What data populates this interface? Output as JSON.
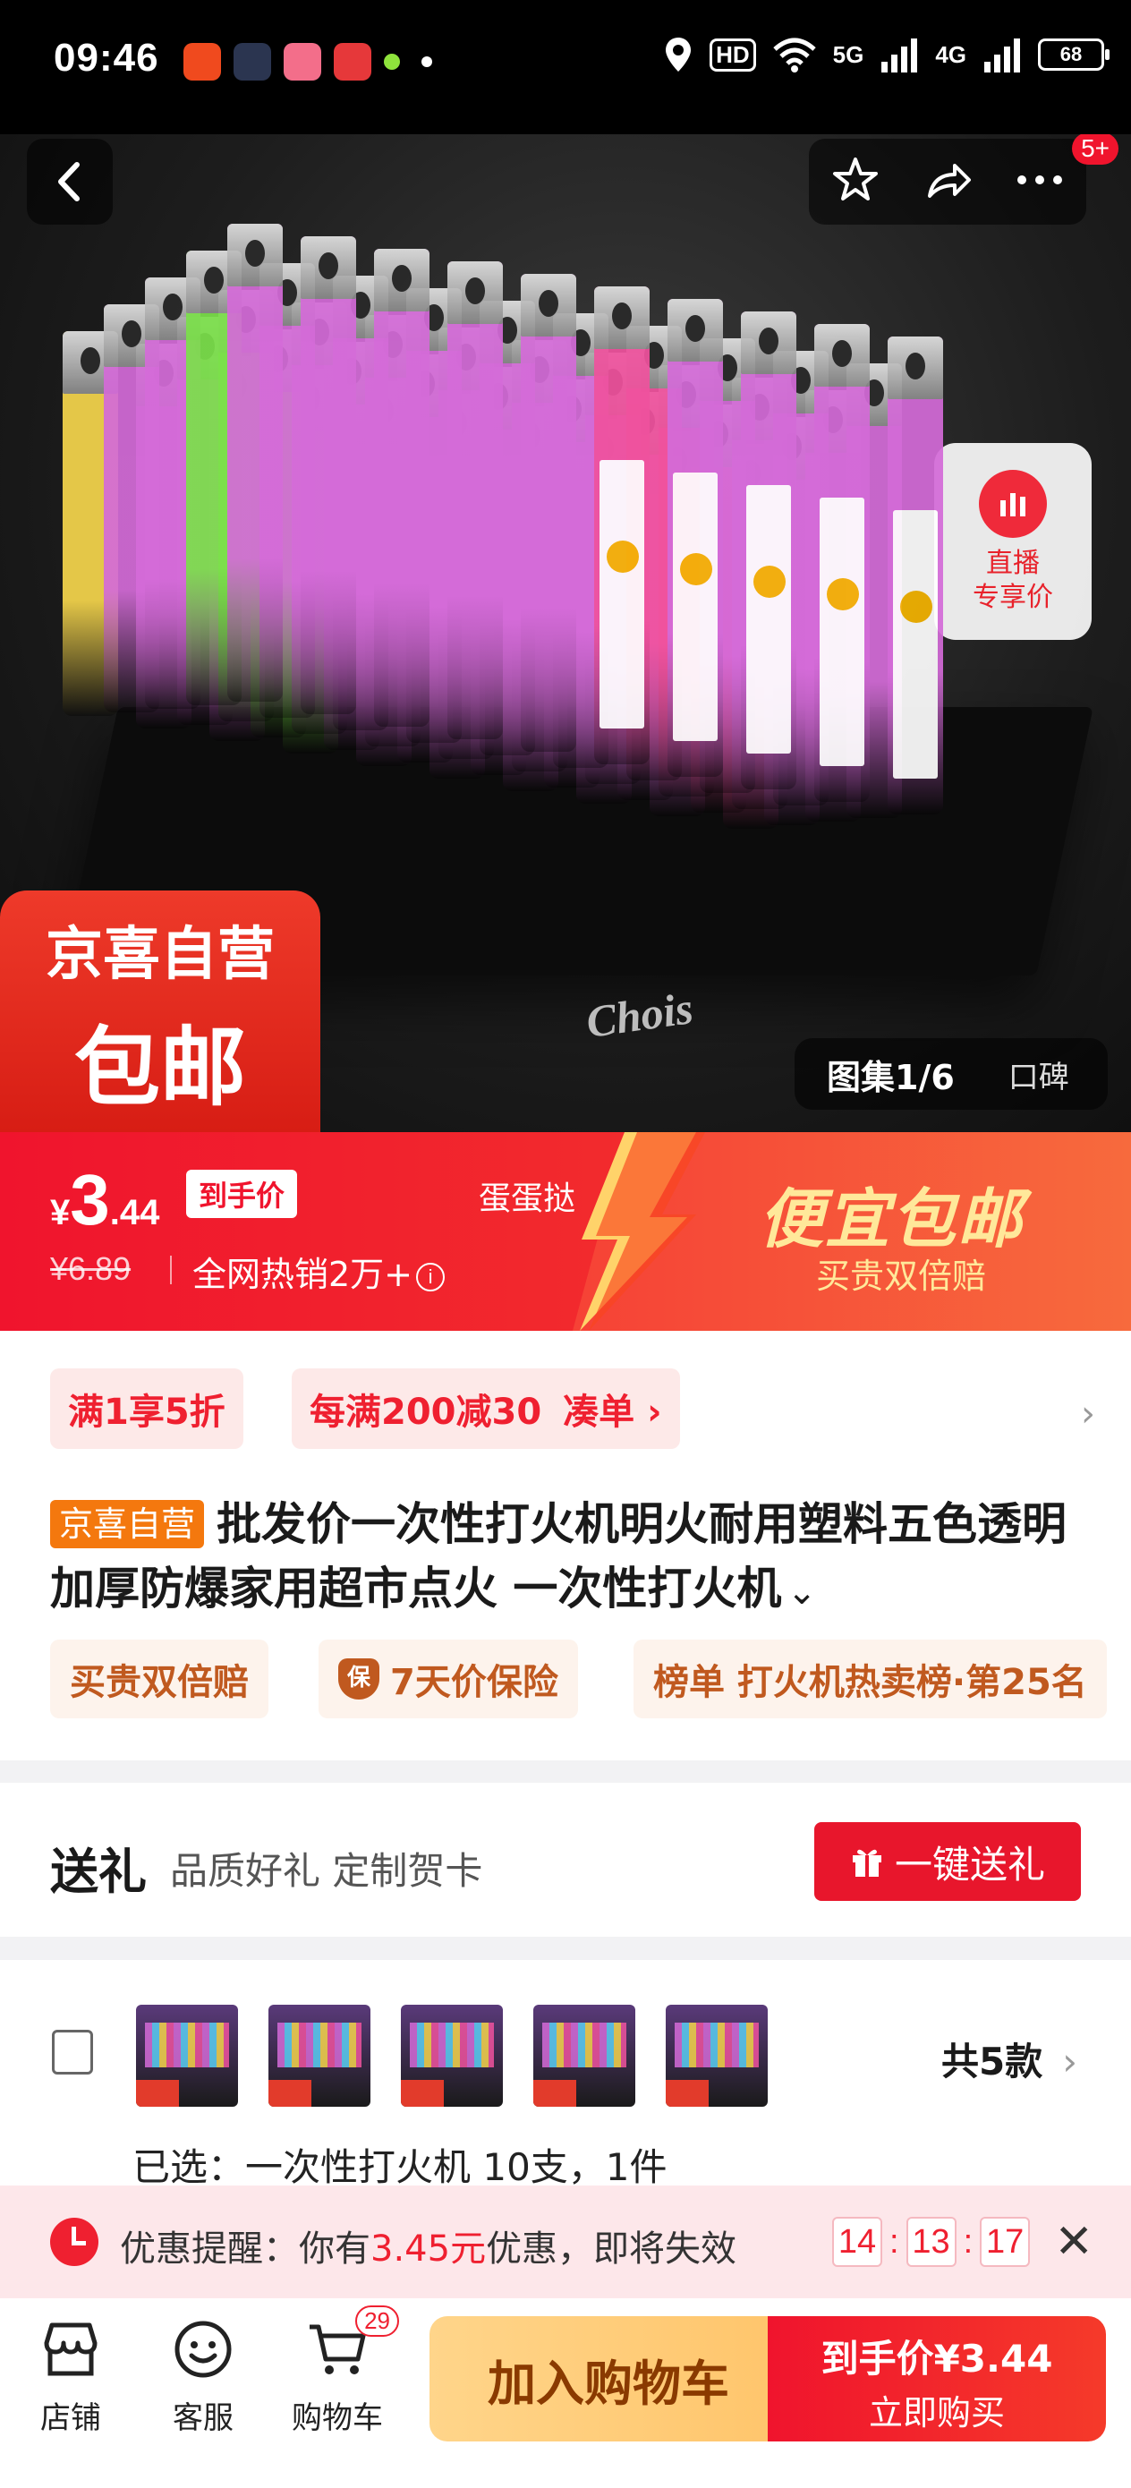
{
  "status_bar": {
    "time": "09:46",
    "hd_label": "HD",
    "network_5g": "5G",
    "network_4g": "4G",
    "battery": "68"
  },
  "hero": {
    "lighter_brand": "Chois",
    "live_label_1": "直播",
    "live_label_2": "专享价",
    "jx_line1": "京喜自营",
    "jx_line2": "包邮",
    "gallery_index": "图集1/6",
    "gallery_reviews": "口碑",
    "more_badge": "5+"
  },
  "price_band": {
    "currency": "¥",
    "price_int": "3",
    "price_dec": ".44",
    "final_price_tag": "到手价",
    "seller_name": "蛋蛋挞",
    "original_price": "¥6.89",
    "sales_text": "全网热销2万+",
    "info_glyph": "i",
    "promo_title": "便宜包邮",
    "promo_sub": "买贵双倍赔"
  },
  "coupons": {
    "chip1": "满1享5折",
    "chip2": "每满200减30",
    "chip2_action": "凑单 ›"
  },
  "product": {
    "tag": "京喜自营",
    "title": "批发价一次性打火机明火耐用塑料五色透明加厚防爆家用超市点火 一次性打火机",
    "expand": "⌄"
  },
  "features": {
    "f1": "买贵双倍赔",
    "f2": "7天价保险",
    "f2_icon": "保",
    "f3": "榜单 打火机热卖榜·第25名"
  },
  "gift": {
    "title": "送礼",
    "subtitle": "品质好礼 定制贺卡",
    "button": "一键送礼"
  },
  "spec": {
    "count": "共5款",
    "selected": "已选：一次性打火机 10支，1件"
  },
  "notice": {
    "prefix": "优惠提醒：你有",
    "amount": "3.45元",
    "suffix": "优惠，即将失效",
    "hh": "14",
    "mm": "13",
    "ss": "17",
    "sep": ":"
  },
  "bottom_bar": {
    "store": "店铺",
    "service": "客服",
    "cart": "购物车",
    "cart_count": "29",
    "add_to_cart": "加入购物车",
    "buy_price": "到手价¥3.44",
    "buy_now": "立即购买"
  },
  "colors": {
    "brand_red": "#f0142d",
    "promo_yellow": "#ffe89a",
    "cart_button": "#ffc56b"
  }
}
